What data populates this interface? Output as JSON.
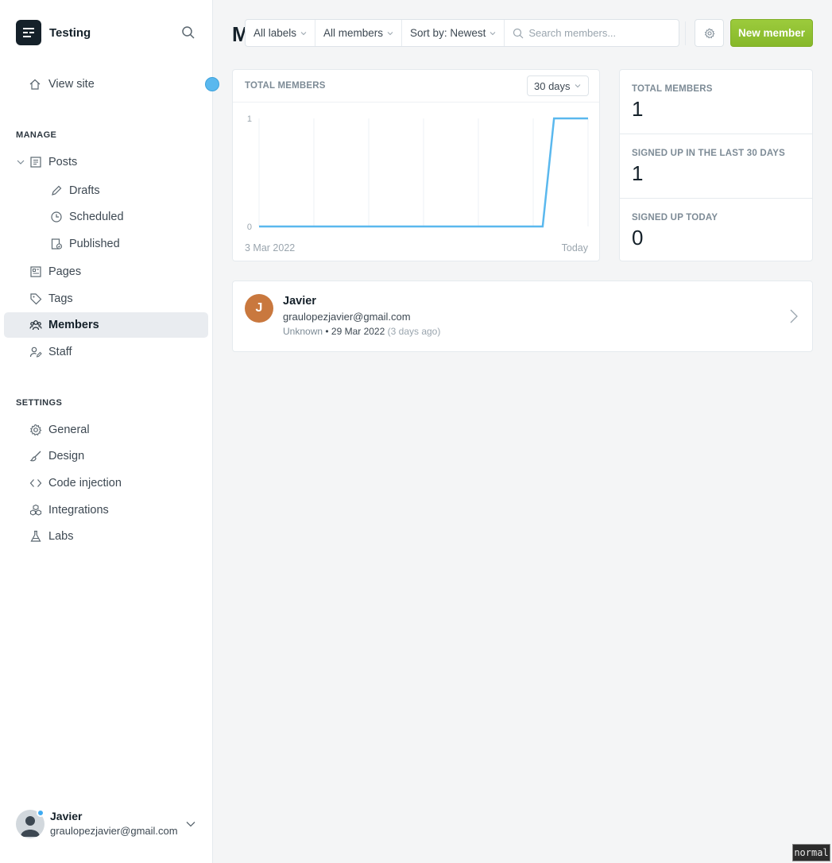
{
  "sidebar": {
    "site_name": "Testing",
    "view_site": "View site",
    "manage_title": "MANAGE",
    "settings_title": "SETTINGS",
    "manage_items": [
      {
        "label": "Posts",
        "icon": "posts-icon"
      },
      {
        "label": "Drafts",
        "icon": "pencil-icon"
      },
      {
        "label": "Scheduled",
        "icon": "clock-icon"
      },
      {
        "label": "Published",
        "icon": "published-icon"
      },
      {
        "label": "Pages",
        "icon": "pages-icon"
      },
      {
        "label": "Tags",
        "icon": "tag-icon"
      },
      {
        "label": "Members",
        "icon": "members-icon",
        "active": true
      },
      {
        "label": "Staff",
        "icon": "staff-icon"
      }
    ],
    "settings_items": [
      {
        "label": "General",
        "icon": "gear-icon"
      },
      {
        "label": "Design",
        "icon": "brush-icon"
      },
      {
        "label": "Code injection",
        "icon": "code-icon"
      },
      {
        "label": "Integrations",
        "icon": "integrations-icon"
      },
      {
        "label": "Labs",
        "icon": "flask-icon"
      }
    ],
    "user": {
      "name": "Javier",
      "email": "graulopezjavier@gmail.com"
    }
  },
  "header": {
    "title": "M",
    "filters": {
      "labels": "All labels",
      "members": "All members",
      "sort": "Sort by: Newest"
    },
    "search_placeholder": "Search members...",
    "new_button": "New member"
  },
  "chart": {
    "label": "TOTAL MEMBERS",
    "range": "30 days",
    "x_start": "3 Mar 2022",
    "x_end": "Today",
    "y_max_label": "1",
    "y_min_label": "0"
  },
  "chart_data": {
    "type": "line",
    "title": "TOTAL MEMBERS",
    "xlabel": "",
    "ylabel": "",
    "x": [
      "3 Mar 2022",
      "",
      "",
      "",
      "",
      "",
      "",
      "",
      "",
      "",
      "",
      "",
      "",
      "",
      "",
      "",
      "",
      "",
      "",
      "",
      "",
      "",
      "",
      "",
      "",
      "",
      "",
      "",
      "",
      "Today"
    ],
    "series": [
      {
        "values": [
          0,
          0,
          0,
          0,
          0,
          0,
          0,
          0,
          0,
          0,
          0,
          0,
          0,
          0,
          0,
          0,
          0,
          0,
          0,
          0,
          0,
          0,
          0,
          0,
          0,
          0,
          1,
          1,
          1,
          1
        ]
      }
    ],
    "ylim": [
      0,
      1
    ],
    "grid": true,
    "color": "#5ab8ee"
  },
  "stats": [
    {
      "label": "TOTAL MEMBERS",
      "value": "1"
    },
    {
      "label": "SIGNED UP IN THE LAST 30 DAYS",
      "value": "1"
    },
    {
      "label": "SIGNED UP TODAY",
      "value": "0"
    }
  ],
  "members": [
    {
      "initial": "J",
      "name": "Javier",
      "email": "graulopezjavier@gmail.com",
      "location": "Unknown",
      "date": "29 Mar 2022",
      "ago": "(3 days ago)"
    }
  ],
  "mode": "normal"
}
